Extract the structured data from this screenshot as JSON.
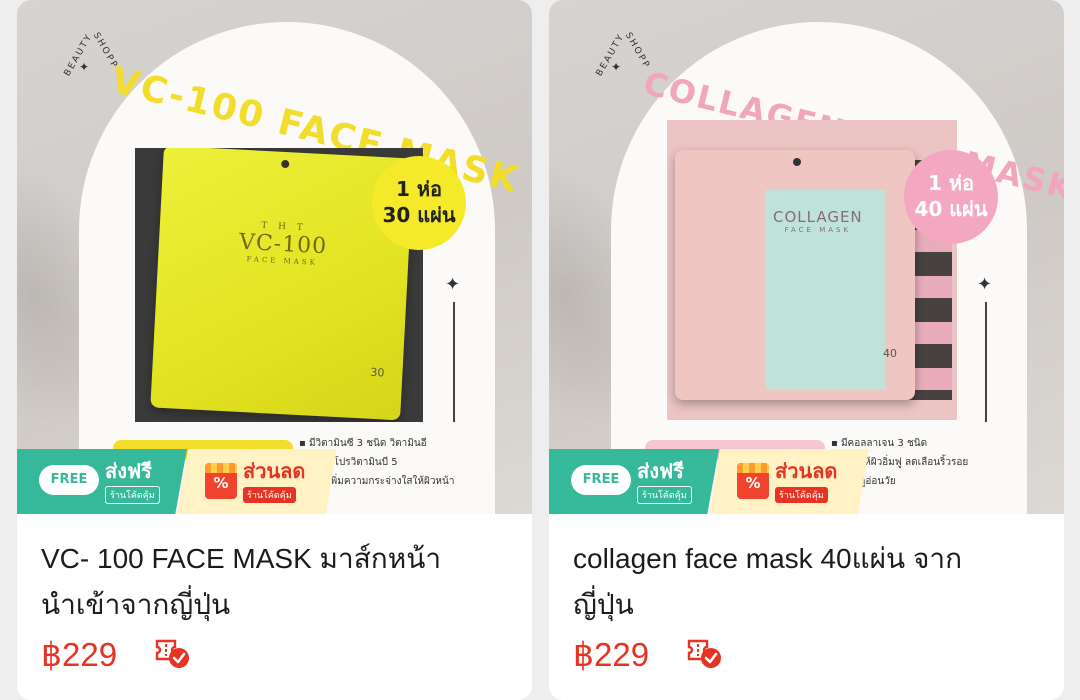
{
  "products": [
    {
      "title_line1": "VC- 100 FACE MASK มาส์กหน้า",
      "title_line2": "นำเข้าจากญี่ปุ่น",
      "price": "฿229",
      "image": {
        "brand_left": "BEAUTY",
        "brand_right": "SHOPP",
        "mask_title": "VC-100 FACE MASK",
        "pack_line1": "1 ห่อ",
        "pack_line2": "30 แผ่น",
        "pouch_top": "T H T",
        "pouch_main": "VC-100",
        "pouch_sub": "FACE MASK",
        "pouch_count": "30",
        "bullets": [
          "มีวิตามินซี 3 ชนิด วิตามินอี",
          "และมีโปรวิตามินบี 5",
          "ช่วยเพิ่มความกระจ่างใสให้ผิวหน้า"
        ],
        "accent_color": "#f2de2a"
      },
      "promo_free_label": "FREE",
      "promo_free_title": "ส่งฟรี",
      "promo_free_sub": "ร้านโค้ดคุ้ม",
      "promo_sale_icon": "%",
      "promo_sale_title": "ส่วนลด",
      "promo_sale_sub": "ร้านโค้ดคุ้ม"
    },
    {
      "title_line1": "collagen face mask 40แผ่น จาก",
      "title_line2": "ญี่ปุ่น",
      "price": "฿229",
      "image": {
        "brand_left": "BEAUTY",
        "brand_right": "SHOPP",
        "mask_title": "COLLAGEN FACE MASK",
        "pack_line1": "1 ห่อ",
        "pack_line2": "40 แผ่น",
        "pouch_main": "COLLAGEN",
        "pouch_sub": "FACE MASK",
        "pouch_count": "40",
        "bullets": [
          "มีคอลลาเจน 3 ชนิด",
          "ช่วยให้ผิวอิ่มฟู ลดเลือนริ้วรอย",
          "และดูอ่อนวัย"
        ],
        "accent_color": "#f4a7c0"
      },
      "promo_free_label": "FREE",
      "promo_free_title": "ส่งฟรี",
      "promo_free_sub": "ร้านโค้ดคุ้ม",
      "promo_sale_icon": "%",
      "promo_sale_title": "ส่วนลด",
      "promo_sale_sub": "ร้านโค้ดคุ้ม"
    }
  ],
  "colors": {
    "price": "#e63324",
    "free_shipping": "#36b89a",
    "discount": "#e63324"
  },
  "icons": [
    "voucher-check-icon",
    "free-shipping-truck-icon",
    "discount-bag-icon"
  ]
}
